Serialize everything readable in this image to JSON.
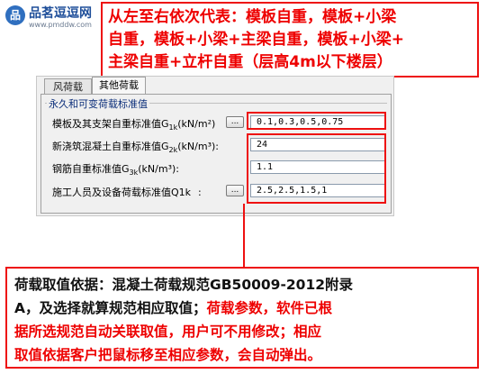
{
  "logo": {
    "mark": "品",
    "name": "品茗逗逗网",
    "url": "www.pmddw.com"
  },
  "top_callout": {
    "lines": [
      "从左至右依次代表：模板自重，模板+小梁",
      "自重，模板+小梁+主梁自重，模板+小梁+",
      "主梁自重+立杆自重（层高4m以下楼层）"
    ]
  },
  "dialog": {
    "tabs": [
      {
        "label": "风荷载",
        "active": false
      },
      {
        "label": "其他荷载",
        "active": true
      }
    ],
    "group_title": "永久和可变荷载标准值",
    "fields": [
      {
        "label_main": "模板及其支架自重标准值G",
        "label_sub": "1k",
        "label_unit": "(kN/m²)",
        "has_button": true,
        "button_label": "...",
        "value": "0.1,0.3,0.5,0.75"
      },
      {
        "label_main": "新浇筑混凝土自重标准值G",
        "label_sub": "2k",
        "label_unit": "(kN/m³):",
        "has_button": false,
        "value": "24"
      },
      {
        "label_main": "钢筋自重标准值G",
        "label_sub": "3k",
        "label_unit": "(kN/m³):",
        "has_button": false,
        "value": "1.1"
      },
      {
        "label_main": "施工人员及设备荷载标准值Q1k",
        "label_sub": "",
        "label_unit": ":",
        "has_button": true,
        "button_label": "...",
        "value": "2.5,2.5,1.5,1"
      }
    ]
  },
  "bottom_callout": {
    "line1_black": "荷载取值依据：混凝土荷载规范GB50009-2012附录",
    "line2_black": "A，及选择就算规范相应取值；",
    "line2_red": "荷载参数，软件已根",
    "line3_red": "据所选规范自动关联取值，用户可不用修改；相应",
    "line4_red": "取值依据客户把鼠标移至相应参数，会自动弹出。"
  },
  "colors": {
    "callout_red": "#e01010",
    "group_title_blue": "#0b2e7a",
    "logo_blue": "#1f4f9a"
  }
}
